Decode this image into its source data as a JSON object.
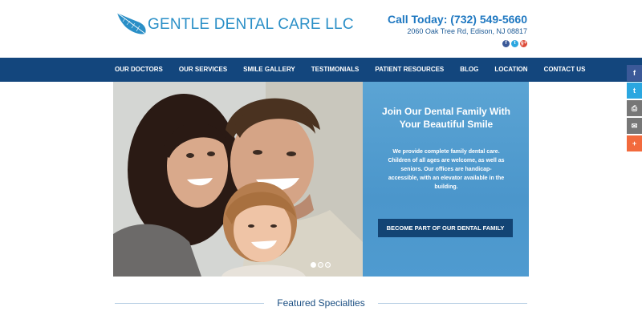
{
  "header": {
    "logo_text": "GENTLE DENTAL CARE LLC",
    "phone": "Call Today: (732) 549-5660",
    "address": "2060 Oak Tree Rd, Edison, NJ  08817",
    "social_icons": [
      {
        "name": "facebook-icon",
        "glyph": "f",
        "color": "#3b5998"
      },
      {
        "name": "twitter-icon",
        "glyph": "t",
        "color": "#2ba7e0"
      },
      {
        "name": "google-plus-icon",
        "glyph": "g+",
        "color": "#dd4b39"
      }
    ]
  },
  "nav": {
    "items": [
      "OUR DOCTORS",
      "OUR SERVICES",
      "SMILE GALLERY",
      "TESTIMONIALS",
      "PATIENT RESOURCES",
      "BLOG",
      "LOCATION",
      "CONTACT US"
    ]
  },
  "hero": {
    "title": "Join Our Dental Family With Your Beautiful Smile",
    "text": "We provide complete family dental care. Children of all ages are welcome, as well as seniors. Our offices are handicap-accessible, with an elevator available in the building.",
    "button": "BECOME PART OF OUR DENTAL FAMILY",
    "slides": 3,
    "active_slide": 1
  },
  "featured": {
    "title": "Featured Specialties"
  },
  "share_bar": [
    {
      "name": "share-facebook-button",
      "glyph": "f",
      "color": "#3b5998"
    },
    {
      "name": "share-twitter-button",
      "glyph": "t",
      "color": "#2ba7e0"
    },
    {
      "name": "share-print-button",
      "glyph": "⎙",
      "color": "#777777"
    },
    {
      "name": "share-email-button",
      "glyph": "✉",
      "color": "#777777"
    },
    {
      "name": "share-more-button",
      "glyph": "+",
      "color": "#f26a3d"
    }
  ],
  "colors": {
    "brand_blue": "#2a8fc7",
    "nav_blue": "#13467d",
    "panel_blue": "#5ba4d4",
    "button_navy": "#134474"
  }
}
